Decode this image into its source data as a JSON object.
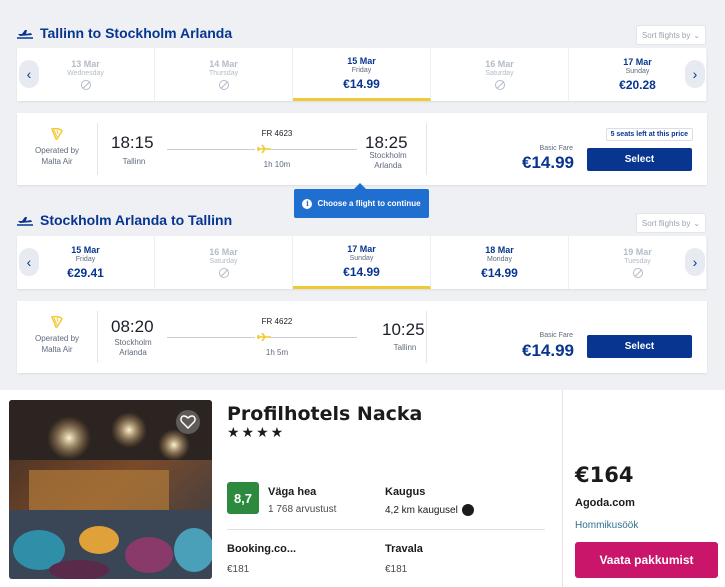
{
  "outbound": {
    "title": "Tallinn to Stockholm Arlanda",
    "sort_label": "Sort flights by",
    "dates": [
      {
        "date": "13 Mar",
        "weekday": "Wednesday",
        "price": null
      },
      {
        "date": "14 Mar",
        "weekday": "Thursday",
        "price": null
      },
      {
        "date": "15 Mar",
        "weekday": "Friday",
        "price": "€14.99"
      },
      {
        "date": "16 Mar",
        "weekday": "Saturday",
        "price": null
      },
      {
        "date": "17 Mar",
        "weekday": "Sunday",
        "price": "€20.28"
      }
    ],
    "flight": {
      "operated_by": "Operated by",
      "operator": "Malta Air",
      "dep_time": "18:15",
      "dep_city": "Tallinn",
      "flight_no": "FR 4623",
      "duration": "1h 10m",
      "arr_time": "18:25",
      "arr_city_1": "Stockholm",
      "arr_city_2": "Arlanda",
      "fare_label": "Basic Fare",
      "price": "€14.99",
      "seats_left": "5 seats left at this price",
      "select_label": "Select"
    }
  },
  "tooltip": {
    "text": "Choose a flight to continue",
    "icon": "info-icon"
  },
  "inbound": {
    "title": "Stockholm Arlanda to Tallinn",
    "sort_label": "Sort flights by",
    "dates": [
      {
        "date": "15 Mar",
        "weekday": "Friday",
        "price": "€29.41"
      },
      {
        "date": "16 Mar",
        "weekday": "Saturday",
        "price": null
      },
      {
        "date": "17 Mar",
        "weekday": "Sunday",
        "price": "€14.99"
      },
      {
        "date": "18 Mar",
        "weekday": "Monday",
        "price": "€14.99"
      },
      {
        "date": "19 Mar",
        "weekday": "Tuesday",
        "price": null
      }
    ],
    "flight": {
      "operated_by": "Operated by",
      "operator": "Malta Air",
      "dep_time": "08:20",
      "dep_city_1": "Stockholm",
      "dep_city_2": "Arlanda",
      "flight_no": "FR 4622",
      "duration": "1h 5m",
      "arr_time": "10:25",
      "arr_city": "Tallinn",
      "fare_label": "Basic Fare",
      "price": "€14.99",
      "select_label": "Select"
    }
  },
  "hotel": {
    "name": "Profilhotels Nacka",
    "stars": "★★★★",
    "rating": "8,7",
    "rating_word": "Väga hea",
    "reviews": "1 768 arvustust",
    "distance_label": "Kaugus",
    "distance_value": "4,2 km kaugusel",
    "providers": [
      {
        "name": "Booking.co...",
        "price": "€181"
      },
      {
        "name": "Travala",
        "price": "€181"
      }
    ],
    "best_price": "€164",
    "best_provider": "Agoda.com",
    "best_meal": "Hommikusöök",
    "deal_label": "Vaata pakkumist"
  },
  "colors": {
    "primary": "#073590",
    "accent_yellow": "#f1c933",
    "tooltip_blue": "#1f6fd1",
    "rating_green": "#2c8a3f",
    "deal_pink": "#c9166a"
  }
}
